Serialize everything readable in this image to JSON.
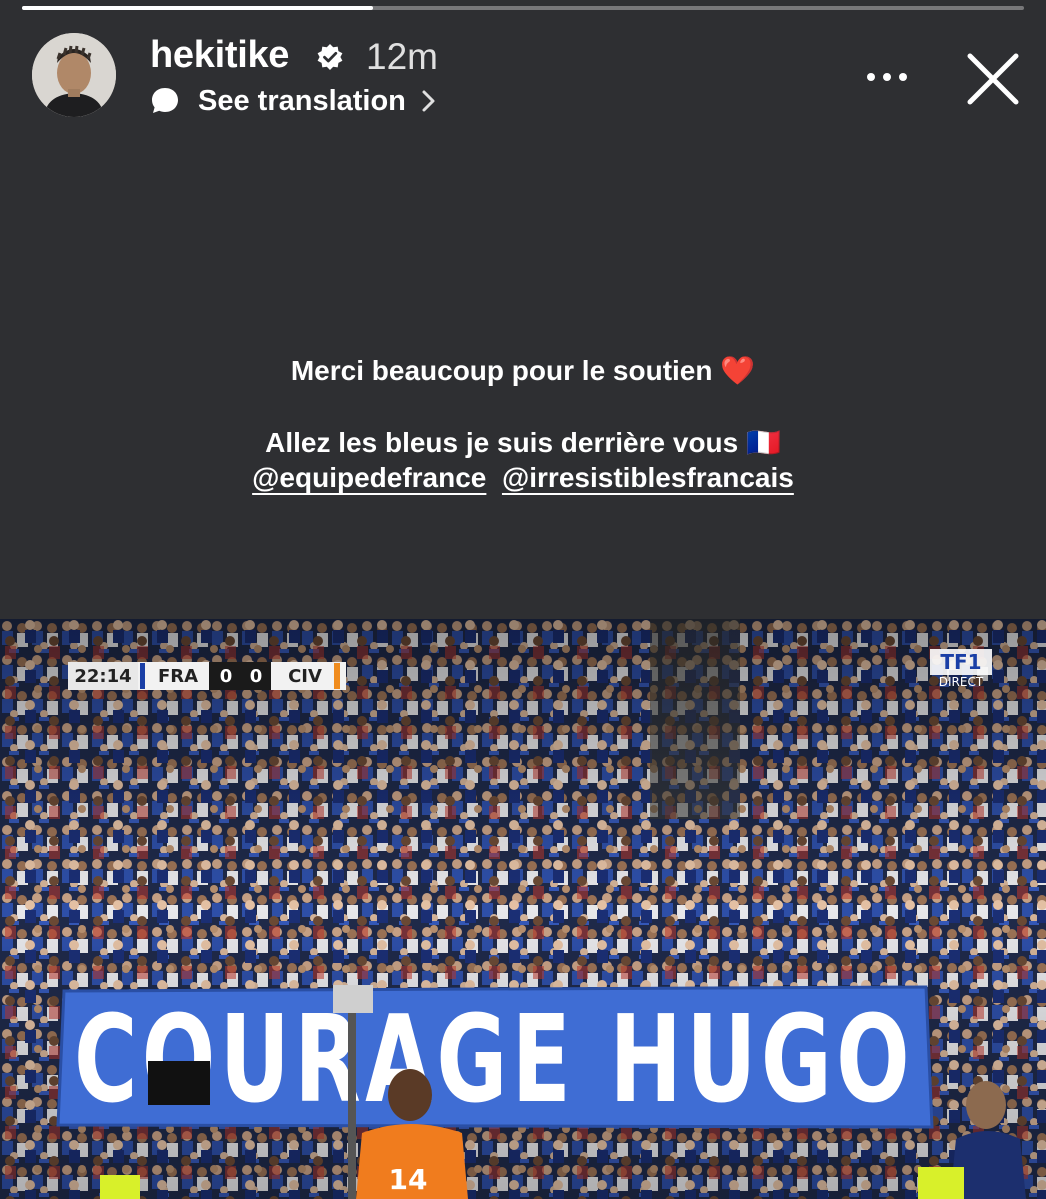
{
  "story": {
    "progress_fraction": 0.35,
    "username": "hekitike",
    "verified": true,
    "time_ago": "12m",
    "translation_label": "See translation",
    "icons": {
      "verified": "verified-badge-icon",
      "translate": "speech-bubble-icon",
      "chevron": "chevron-right-icon",
      "more": "more-options-icon",
      "close": "close-icon"
    }
  },
  "caption": {
    "line1": "Merci beaucoup pour le soutien ❤️",
    "line2": "Allez les bleus je suis derrière vous 🇫🇷",
    "mention1": "@equipedefrance",
    "mention2": "@irresistiblesfrancais"
  },
  "media": {
    "scoreboard": {
      "clock": "22:14",
      "home": "FRA",
      "home_score": "0",
      "away_score": "0",
      "away": "CIV"
    },
    "broadcaster": {
      "logo": "TF1",
      "tag": "DIRECT"
    },
    "banner_text": "COURAGE HUGO",
    "player_number": "14"
  }
}
